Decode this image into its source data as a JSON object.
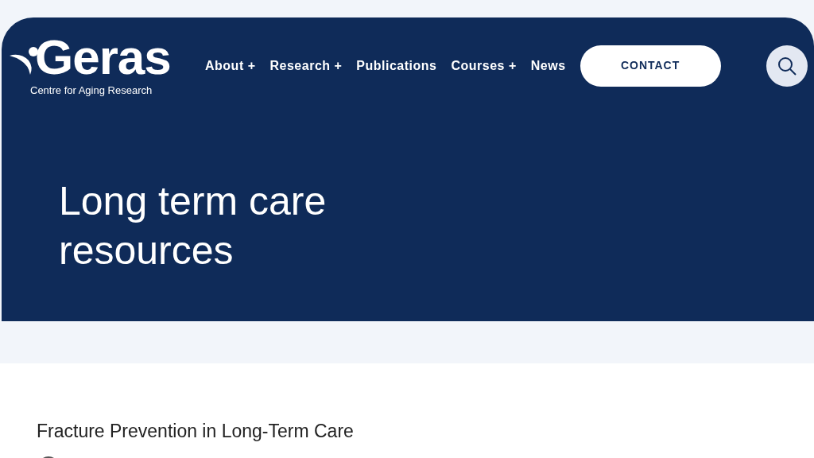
{
  "logo": {
    "name": "Geras",
    "tagline": "Centre for Aging Research"
  },
  "nav": [
    {
      "label": "About",
      "expander": "+"
    },
    {
      "label": "Research",
      "expander": "+"
    },
    {
      "label": "Publications"
    },
    {
      "label": "Courses",
      "expander": "+"
    },
    {
      "label": "News"
    }
  ],
  "contact_button": "CONTACT",
  "hero": {
    "title": "Long term care resources"
  },
  "section": {
    "heading": "Fracture Prevention in Long-Term Care"
  }
}
